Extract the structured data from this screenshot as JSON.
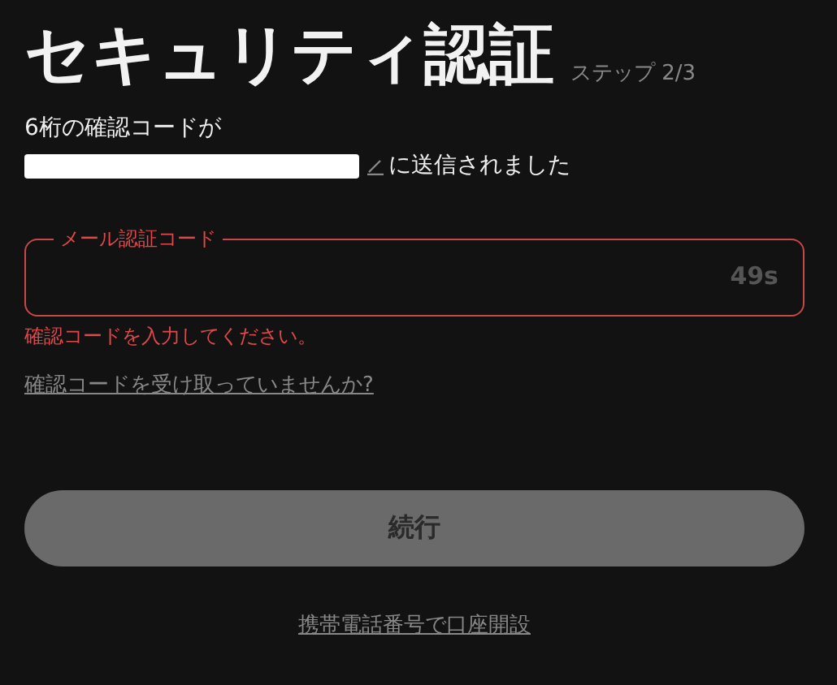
{
  "header": {
    "title": "セキュリティ認証",
    "step": "ステップ 2/3"
  },
  "message": {
    "line_1": "6桁の確認コードが",
    "suffix": "に送信されました"
  },
  "code_field": {
    "label": "メール認証コード",
    "countdown": "49s",
    "error": true,
    "error_text": "確認コードを入力してください。"
  },
  "help_link": "確認コードを受け取っていませんか?",
  "continue_button": {
    "label": "続行",
    "disabled": true
  },
  "phone_link": "携帯電話番号で口座開設"
}
